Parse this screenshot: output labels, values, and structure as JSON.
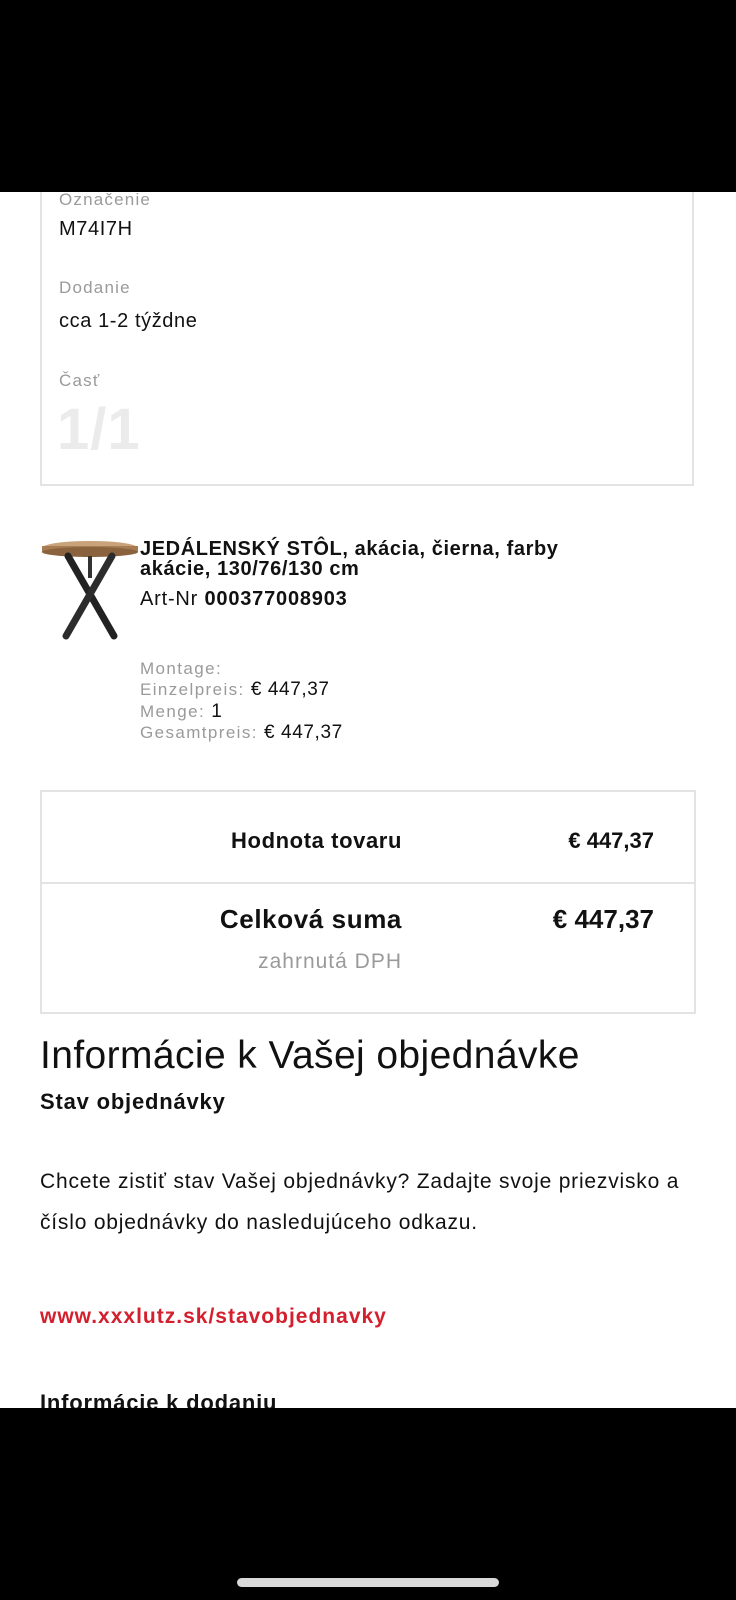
{
  "delivery_card": {
    "designation_label": "Označenie",
    "designation_value": "M74I7H",
    "delivery_label": "Dodanie",
    "delivery_value": "cca 1-2 týždne",
    "part_label": "Časť",
    "part_value": "1/1"
  },
  "product": {
    "title_line1": "JEDÁLENSKÝ STÔL, akácia, čierna, farby",
    "title_line2": "akácie, 130/76/130 cm",
    "art_label": "Art-Nr",
    "art_number": "000377008903",
    "montage_label": "Montage:",
    "unit_price_label": "Einzelpreis:",
    "unit_price_value": "€ 447,37",
    "quantity_label": "Menge:",
    "quantity_value": "1",
    "total_price_label": "Gesamtpreis:",
    "total_price_value": "€ 447,37",
    "image_icon": "round-dining-table-image"
  },
  "totals": {
    "goods_value_label": "Hodnota tovaru",
    "goods_value": "€ 447,37",
    "total_label": "Celková suma",
    "total_value": "€ 447,37",
    "vat_note": "zahrnutá DPH"
  },
  "order_info": {
    "title": "Informácie k Vašej objednávke",
    "status_heading": "Stav objednávky",
    "paragraph": "Chcete zistiť stav Vašej objednávky? Zadajte svoje priezvisko a číslo objednávky do nasledujúceho odkazu.",
    "link": "www.xxxlutz.sk/stavobjednavky",
    "next_heading": "Informácie k dodaniu"
  },
  "colors": {
    "link_red": "#d4202e",
    "muted_gray": "#9a9a9a",
    "border_gray": "#e3e3e3"
  }
}
